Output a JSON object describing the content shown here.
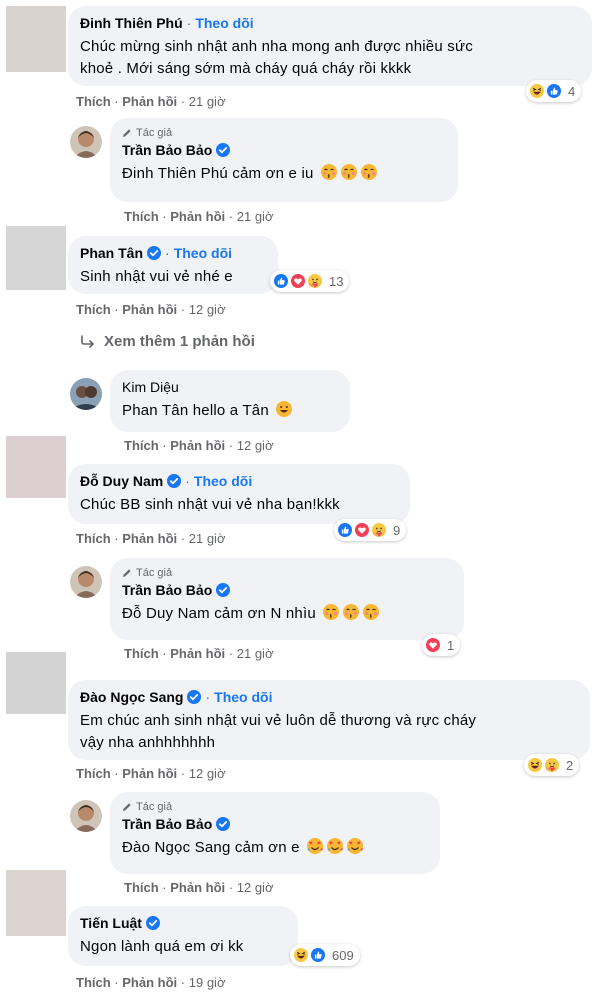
{
  "comments": [
    {
      "name": "Đinh Thiên Phú",
      "follow": "Theo dõi",
      "text_line1": "Chúc mừng sinh nhật anh nha mong anh được nhiều sức",
      "text_line2": "khoẻ . Mới sáng sớm mà cháy quá cháy rồi kkkk",
      "like": "Thích",
      "reply": "Phản hồi",
      "time": "21 giờ",
      "reaction_count": "4",
      "reactions": [
        "haha",
        "like"
      ]
    },
    {
      "author_tag": "Tác giả",
      "name": "Trần Bảo Bảo",
      "text": "Đinh Thiên Phú cảm ơn e iu",
      "like": "Thích",
      "reply": "Phản hồi",
      "time": "21 giờ"
    },
    {
      "name": "Phan Tân",
      "follow": "Theo dõi",
      "text": "Sinh nhật vui vẻ nhé e",
      "like": "Thích",
      "reply": "Phản hồi",
      "time": "12 giờ",
      "reaction_count": "13",
      "reactions": [
        "like",
        "love",
        "care"
      ]
    },
    {
      "name": "Kim Diệu",
      "text": "Phan Tân hello a Tân",
      "like": "Thích",
      "reply": "Phản hồi",
      "time": "12 giờ"
    },
    {
      "name": "Đỗ Duy Nam",
      "follow": "Theo dõi",
      "text": "Chúc BB sinh nhật vui vẻ nha bạn!kkk",
      "like": "Thích",
      "reply": "Phản hồi",
      "time": "21 giờ",
      "reaction_count": "9",
      "reactions": [
        "like",
        "love",
        "care"
      ]
    },
    {
      "author_tag": "Tác giả",
      "name": "Trần Bảo Bảo",
      "text": "Đỗ Duy Nam cảm ơn N nhìu",
      "like": "Thích",
      "reply": "Phản hồi",
      "time": "21 giờ",
      "reaction_count": "1",
      "reactions": [
        "love"
      ]
    },
    {
      "name": "Đào Ngọc Sang",
      "follow": "Theo dõi",
      "text_line1": "Em chúc anh sinh nhật vui vẻ luôn dễ thương và rực cháy",
      "text_line2": "vậy nha anhhhhhhh",
      "like": "Thích",
      "reply": "Phản hồi",
      "time": "12 giờ",
      "reaction_count": "2",
      "reactions": [
        "haha",
        "care"
      ]
    },
    {
      "author_tag": "Tác giả",
      "name": "Trần Bảo Bảo",
      "text": "Đào Ngọc Sang cảm ơn e",
      "like": "Thích",
      "reply": "Phản hồi",
      "time": "12 giờ"
    },
    {
      "name": "Tiến Luật",
      "text": "Ngon lành quá em ơi kk",
      "like": "Thích",
      "reply": "Phản hồi",
      "time": "19 giờ",
      "reaction_count": "609",
      "reactions": [
        "haha",
        "like"
      ]
    }
  ],
  "more_replies": "Xem thêm 1 phản hồi",
  "dot": "·",
  "colors": {
    "link": "#1877f2",
    "bubble": "#f0f2f5",
    "meta": "#65676b"
  }
}
